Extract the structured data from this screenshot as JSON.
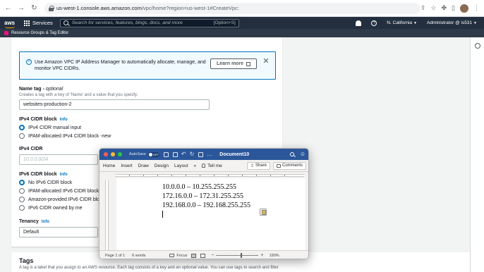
{
  "browser": {
    "url_host": "us-west-1.console.aws.amazon.com",
    "url_path": "/vpc/home?region=us-west-1#CreateVpc:"
  },
  "aws_nav": {
    "logo": "aws",
    "services_label": "Services",
    "search_placeholder": "Search for services, features, blogs, docs, and more",
    "search_shortcut": "[Option+S]",
    "region": "N. California",
    "account": "Administrator @ is531",
    "subnav_label": "Resource Groups & Tag Editor"
  },
  "alert": {
    "text": "Use Amazon VPC IP Address Manager to automatically allocate, manage, and monitor VPC CIDRs.",
    "learn_more": "Learn more",
    "close_glyph": "✕"
  },
  "form": {
    "name_tag_label": "Name tag - ",
    "name_tag_optional": "optional",
    "name_tag_desc": "Creates a tag with a key of 'Name' and a value that you specify.",
    "name_tag_value": "websites-production-2",
    "ipv4_block_label": "IPv4 CIDR block",
    "info": "Info",
    "ipv4_opt_manual": "IPv4 CIDR manual input",
    "ipv4_opt_ipam": "IPAM-allocated IPv4 CIDR block - ",
    "ipv4_opt_ipam_new": "new",
    "ipv4_cidr_label": "IPv4 CIDR",
    "ipv4_cidr_placeholder": "10.0.0.0/24",
    "ipv6_block_label": "IPv6 CIDR block",
    "ipv6_opt_none": "No IPv6 CIDR block",
    "ipv6_opt_ipam": "IPAM-allocated IPv6 CIDR block -",
    "ipv6_opt_amazon": "Amazon-provided IPv6 CIDR block",
    "ipv6_opt_owned": "IPv6 CIDR owned by me",
    "tenancy_label": "Tenancy",
    "tenancy_value": "Default"
  },
  "tags_section": {
    "title": "Tags",
    "desc": "A tag is a label that you assign to an AWS resource. Each tag consists of a key and an optional value. You can use tags to search and filter"
  },
  "word": {
    "autosave": "AutoSave",
    "toggle": "OFF",
    "doc_title": "Document10",
    "tabs": [
      "Home",
      "Insert",
      "Draw",
      "Design",
      "Layout"
    ],
    "tell_me": "Tell me",
    "share": "Share",
    "comments": "Comments",
    "lines": [
      "10.0.0.0 – 10.255.255.255",
      "172.16.0.0 – 172.31.255.255",
      "192.168.0.0 – 192.168.255.255"
    ],
    "page_status": "Page 1 of 1",
    "words": "6 words",
    "focus": "Focus",
    "zoom": "190%"
  }
}
